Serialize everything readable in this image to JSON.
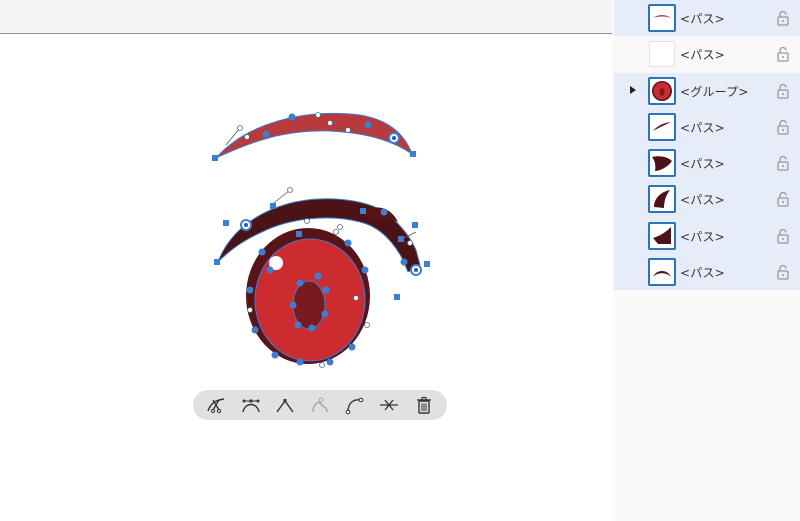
{
  "toolbar": {
    "tools": [
      {
        "icon": "cut-path-icon"
      },
      {
        "icon": "smooth-anchor-icon"
      },
      {
        "icon": "corner-anchor-icon"
      },
      {
        "icon": "join-anchor-icon",
        "disabled": true
      },
      {
        "icon": "curve-path-icon"
      },
      {
        "icon": "delete-anchor-icon"
      },
      {
        "icon": "trash-icon"
      }
    ]
  },
  "layers": {
    "items": [
      {
        "name": "<パス>",
        "thumb": "eyebrow",
        "selected": true
      },
      {
        "name": "<パス>",
        "thumb": "blank",
        "selected": false
      },
      {
        "name": "<グループ>",
        "thumb": "iris",
        "selected": true,
        "expandable": true
      },
      {
        "name": "<パス>",
        "thumb": "upper-line",
        "selected": true
      },
      {
        "name": "<パス>",
        "thumb": "lash-left",
        "selected": true
      },
      {
        "name": "<パス>",
        "thumb": "lash-curve",
        "selected": true
      },
      {
        "name": "<パス>",
        "thumb": "lash-wedge",
        "selected": true
      },
      {
        "name": "<パス>",
        "thumb": "arc",
        "selected": true
      }
    ]
  },
  "colors": {
    "accent": "#2b74b5",
    "selection_blue": "#3b7fd1",
    "eye_red": "#cc2b30",
    "lash_dark": "#5a1418",
    "eyebrow_red": "#b83a3d",
    "panel_selected": "#e6edf8"
  }
}
